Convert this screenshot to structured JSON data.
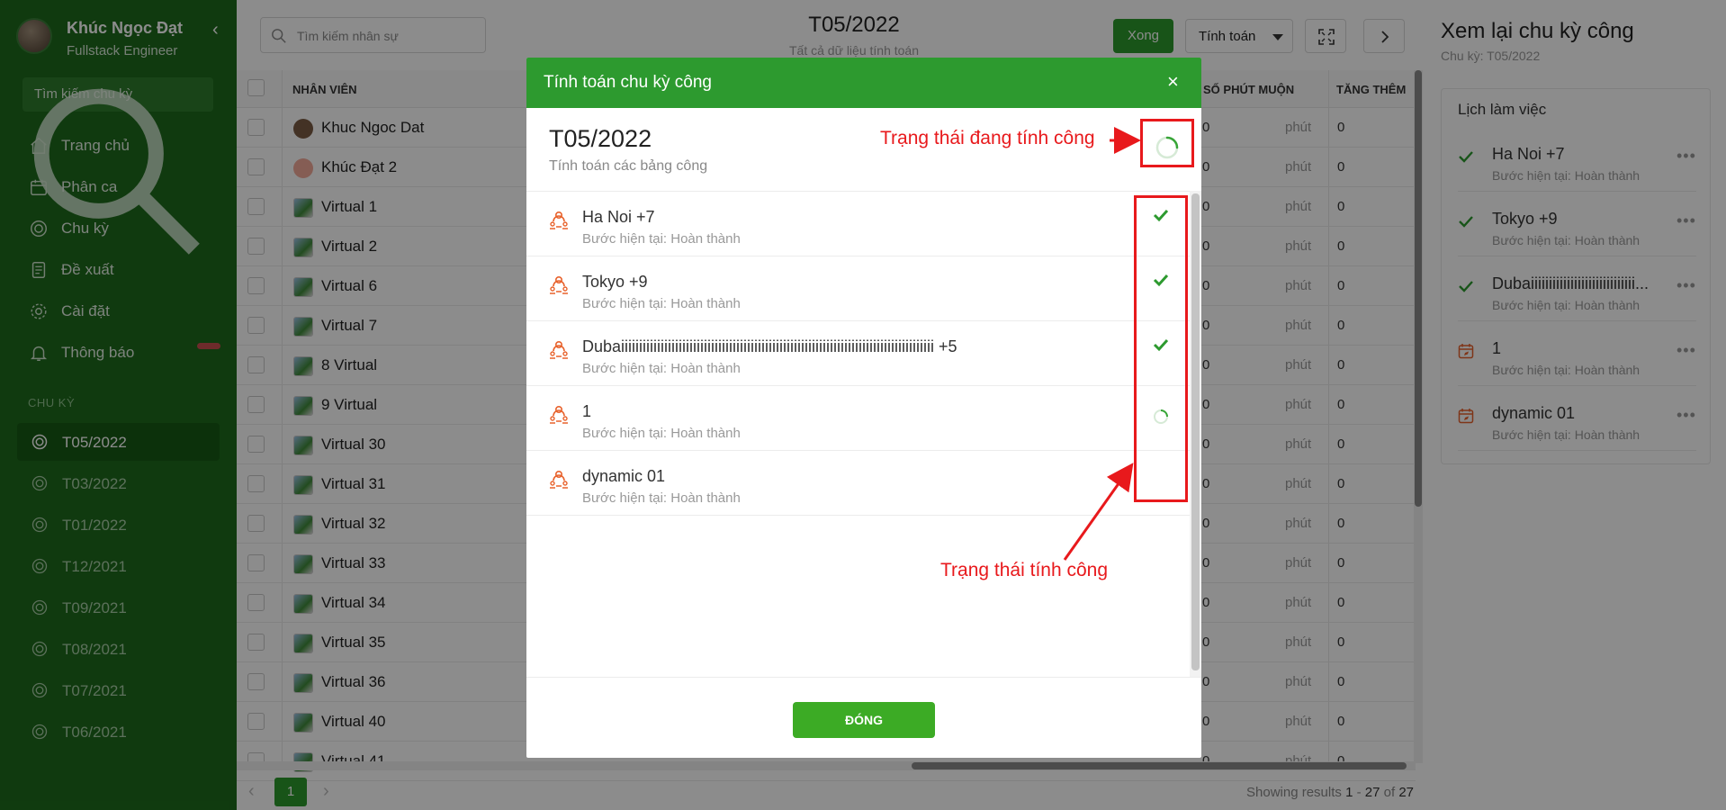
{
  "profile": {
    "name": "Khúc Ngọc Đạt",
    "role": "Fullstack Engineer"
  },
  "sidebar": {
    "search_placeholder": "Tìm kiếm chu kỳ",
    "nav": [
      {
        "label": "Trang chủ",
        "icon": "home-icon"
      },
      {
        "label": "Phân ca",
        "icon": "calendar-icon"
      },
      {
        "label": "Chu kỳ",
        "icon": "target-icon"
      },
      {
        "label": "Đề xuất",
        "icon": "document-icon"
      },
      {
        "label": "Cài đặt",
        "icon": "gear-icon"
      },
      {
        "label": "Thông báo",
        "icon": "bell-icon"
      }
    ],
    "section_title": "CHU KỲ",
    "cycles": [
      "T05/2022",
      "T03/2022",
      "T01/2022",
      "T12/2021",
      "T09/2021",
      "T08/2021",
      "T07/2021",
      "T06/2021"
    ]
  },
  "main": {
    "search_placeholder": "Tìm kiếm nhân sự",
    "period": "T05/2022",
    "period_sub": "Tất cả dữ liệu tính toán",
    "done_label": "Xong",
    "calc_label": "Tính toán",
    "columns": {
      "employee": "NHÂN VIÊN",
      "late": "SỐ PHÚT MUỘN",
      "extra": "TĂNG THÊM"
    },
    "rows": [
      {
        "name": "Khuc Ngoc Dat",
        "late": "0",
        "unit": "phút",
        "extra": "0"
      },
      {
        "name": "Khúc Đạt 2",
        "late": "0",
        "unit": "phút",
        "extra": "0"
      },
      {
        "name": "Virtual 1",
        "late": "0",
        "unit": "phút",
        "extra": "0"
      },
      {
        "name": "Virtual 2",
        "late": "0",
        "unit": "phút",
        "extra": "0"
      },
      {
        "name": "Virtual 6",
        "late": "0",
        "unit": "phút",
        "extra": "0"
      },
      {
        "name": "Virtual 7",
        "late": "0",
        "unit": "phút",
        "extra": "0"
      },
      {
        "name": "8 Virtual",
        "late": "0",
        "unit": "phút",
        "extra": "0"
      },
      {
        "name": "9 Virtual",
        "late": "0",
        "unit": "phút",
        "extra": "0"
      },
      {
        "name": "Virtual 30",
        "late": "0",
        "unit": "phút",
        "extra": "0"
      },
      {
        "name": "Virtual 31",
        "late": "0",
        "unit": "phút",
        "extra": "0"
      },
      {
        "name": "Virtual 32",
        "late": "0",
        "unit": "phút",
        "extra": "0"
      },
      {
        "name": "Virtual 33",
        "late": "0",
        "unit": "phút",
        "extra": "0"
      },
      {
        "name": "Virtual 34",
        "late": "0",
        "unit": "phút",
        "extra": "0"
      },
      {
        "name": "Virtual 35",
        "late": "0",
        "unit": "phút",
        "extra": "0"
      },
      {
        "name": "Virtual 36",
        "late": "0",
        "unit": "phút",
        "extra": "0"
      },
      {
        "name": "Virtual 40",
        "late": "0",
        "unit": "phút",
        "extra": "0"
      },
      {
        "name": "Virtual 41",
        "late": "0",
        "unit": "phút",
        "extra": "0"
      }
    ],
    "pager": {
      "page": "1",
      "results_prefix": "Showing results",
      "from": "1",
      "to": "27",
      "of_word": "of",
      "total": "27"
    }
  },
  "right_panel": {
    "title": "Xem lại chu kỳ công",
    "subtitle": "Chu kỳ: T05/2022",
    "card_title": "Lịch làm việc",
    "items": [
      {
        "name": "Ha Noi +7",
        "status": "Bước hiện tại: Hoàn thành",
        "icon": "check-icon"
      },
      {
        "name": "Tokyo +9",
        "status": "Bước hiện tại: Hoàn thành",
        "icon": "check-icon"
      },
      {
        "name": "Dubaiiiiiiiiiiiiiiiiiiiiiiiiiiiii...",
        "status": "Bước hiện tại: Hoàn thành",
        "icon": "check-icon"
      },
      {
        "name": "1",
        "status": "Bước hiện tại: Hoàn thành",
        "icon": "calendar-edit-icon"
      },
      {
        "name": "dynamic 01",
        "status": "Bước hiện tại: Hoàn thành",
        "icon": "calendar-edit-icon"
      }
    ]
  },
  "modal": {
    "title": "Tính toán chu kỳ công",
    "period": "T05/2022",
    "description": "Tính toán các bảng công",
    "items": [
      {
        "name": "Ha Noi +7",
        "status": "Bước hiện tại: Hoàn thành",
        "state": "done"
      },
      {
        "name": "Tokyo +9",
        "status": "Bước hiện tại: Hoàn thành",
        "state": "done"
      },
      {
        "name": "Dubaiiiiiiiiiiiiiiiiiiiiiiiiiiiiiiiiiiiiiiiiiiiiiiiiiiiiiiiiiiiiiiiiiiiiiiiiiiiiiiiiiiiiiii +5",
        "status": "Bước hiện tại: Hoàn thành",
        "state": "done"
      },
      {
        "name": "1",
        "status": "Bước hiện tại: Hoàn thành",
        "state": "processing"
      },
      {
        "name": "dynamic 01",
        "status": "Bước hiện tại: Hoàn thành",
        "state": "pending"
      }
    ],
    "close_label": "ĐÓNG"
  },
  "annotations": {
    "processing_label": "Trạng thái đang tính công",
    "status_label": "Trạng thái tính công"
  },
  "colors": {
    "sidebar": "#1e6b1c",
    "primary": "#2d9a2f",
    "annotation": "#e8191c",
    "icon_orange": "#e8622c"
  }
}
